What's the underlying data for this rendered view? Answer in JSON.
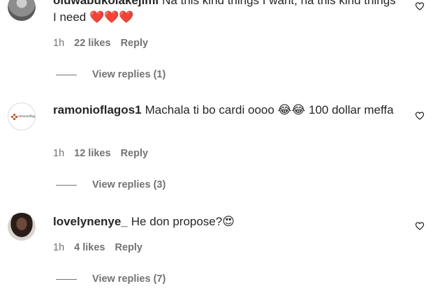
{
  "comments": [
    {
      "username": "oluwabukolakejimi",
      "text": "Na this kind things I want, na this kind things I need ❤️❤️❤️",
      "time": "1h",
      "likes": "22 likes",
      "reply": "Reply",
      "view_replies": "View replies (1)",
      "avatar_icon": "profile-photo-gray"
    },
    {
      "username": "ramonioflagos1",
      "text": "Machala ti bo cardi oooo 😂😂 100 dollar meffa",
      "time": "1h",
      "likes": "12 likes",
      "reply": "Reply",
      "view_replies": "View replies (3)",
      "avatar_icon": "ramonioflagos-logo",
      "avatar_logo_text": "ramonioflagos"
    },
    {
      "username": "lovelynenye_",
      "text": "He don propose?😍",
      "time": "1h",
      "likes": "4 likes",
      "reply": "Reply",
      "view_replies": "View replies (7)",
      "avatar_icon": "profile-photo-woman"
    }
  ],
  "colors": {
    "text": "#262626",
    "secondary": "#737373",
    "background": "#ffffff"
  },
  "like_icon": "heart-outline-icon"
}
